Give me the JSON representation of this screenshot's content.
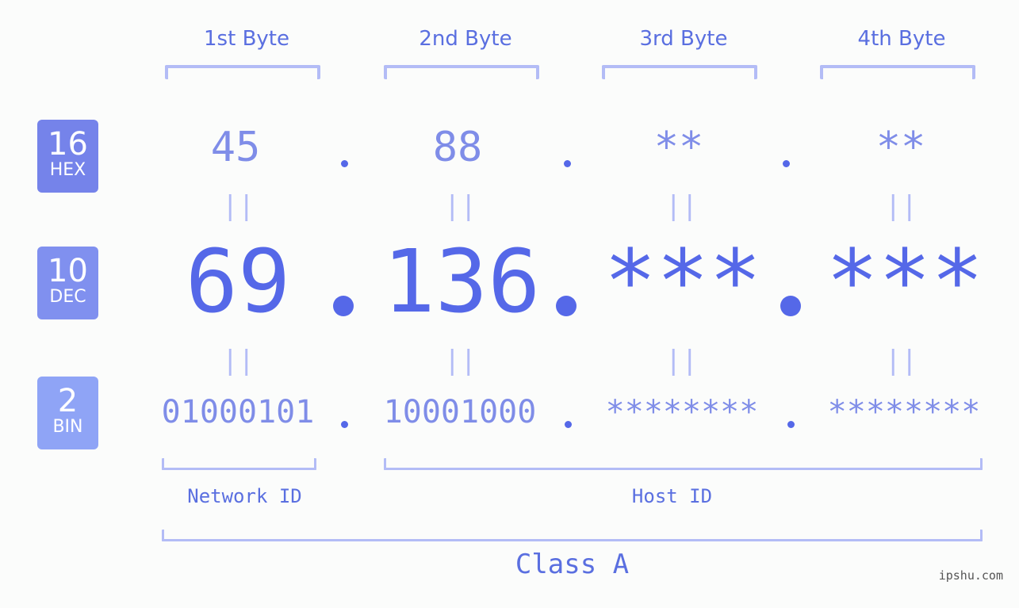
{
  "headers": [
    "1st Byte",
    "2nd Byte",
    "3rd Byte",
    "4th Byte"
  ],
  "badges": {
    "hex": {
      "num": "16",
      "label": "HEX",
      "color": "#7583ea"
    },
    "dec": {
      "num": "10",
      "label": "DEC",
      "color": "#8090ef"
    },
    "bin": {
      "num": "2",
      "label": "BIN",
      "color": "#8fa4f6"
    }
  },
  "hex": [
    "45",
    "88",
    "**",
    "**"
  ],
  "dec": [
    "69",
    "136",
    "***",
    "***"
  ],
  "bin": [
    "01000101",
    "10001000",
    "********",
    "********"
  ],
  "separator": ".",
  "equals": "||",
  "network_label": "Network ID",
  "host_label": "Host ID",
  "class_label": "Class A",
  "watermark": "ipshu.com",
  "colors": {
    "accent": "#5568e8",
    "light": "#7f8de8",
    "bracket": "#b3bcf6"
  }
}
